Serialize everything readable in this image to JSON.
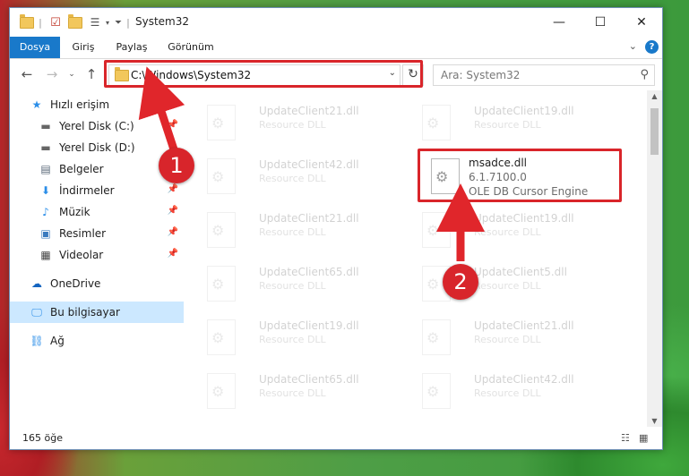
{
  "window": {
    "title": "System32"
  },
  "ribbon": {
    "tabs": [
      {
        "label": "Dosya",
        "active": true
      },
      {
        "label": "Giriş",
        "active": false
      },
      {
        "label": "Paylaş",
        "active": false
      },
      {
        "label": "Görünüm",
        "active": false
      }
    ],
    "help": "?"
  },
  "address": {
    "path": "C:\\Windows\\System32"
  },
  "search": {
    "placeholder": "Ara: System32"
  },
  "sidebar": {
    "items": [
      {
        "label": "Hızlı erişim",
        "icon": "star-icon",
        "pinned": false
      },
      {
        "label": "Yerel Disk (C:)",
        "icon": "drive-icon",
        "pinned": true
      },
      {
        "label": "Yerel Disk (D:)",
        "icon": "drive-icon",
        "pinned": false
      },
      {
        "label": "Belgeler",
        "icon": "document-icon",
        "pinned": true
      },
      {
        "label": "İndirmeler",
        "icon": "download-icon",
        "pinned": true
      },
      {
        "label": "Müzik",
        "icon": "music-icon",
        "pinned": true
      },
      {
        "label": "Resimler",
        "icon": "picture-icon",
        "pinned": true
      },
      {
        "label": "Videolar",
        "icon": "video-icon",
        "pinned": true
      },
      {
        "label": "OneDrive",
        "icon": "cloud-icon",
        "pinned": false
      },
      {
        "label": "Bu bilgisayar",
        "icon": "computer-icon",
        "pinned": false
      },
      {
        "label": "Ağ",
        "icon": "network-icon",
        "pinned": false
      }
    ]
  },
  "files": {
    "left": [
      {
        "name": "UpdateClient21.dll",
        "type": "Resource DLL"
      },
      {
        "name": "UpdateClient42.dll",
        "type": "Resource DLL"
      },
      {
        "name": "UpdateClient21.dll",
        "type": "Resource DLL"
      },
      {
        "name": "UpdateClient65.dll",
        "type": "Resource DLL"
      },
      {
        "name": "UpdateClient19.dll",
        "type": "Resource DLL"
      },
      {
        "name": "UpdateClient65.dll",
        "type": "Resource DLL"
      }
    ],
    "right": [
      {
        "name": "UpdateClient19.dll",
        "type": "Resource DLL"
      },
      {
        "name": "UpdateClient19.dll",
        "type": "Resource DLL"
      },
      {
        "name": "UpdateClient5.dll",
        "type": "Resource DLL"
      },
      {
        "name": "UpdateClient21.dll",
        "type": "Resource DLL"
      },
      {
        "name": "UpdateClient42.dll",
        "type": "Resource DLL"
      }
    ],
    "highlighted": {
      "name": "msadce.dll",
      "version": "6.1.7100.0",
      "description": "OLE DB Cursor Engine"
    }
  },
  "status": {
    "count": "165 öğe"
  },
  "annotations": {
    "step1": "1",
    "step2": "2",
    "color": "#d9252a"
  }
}
